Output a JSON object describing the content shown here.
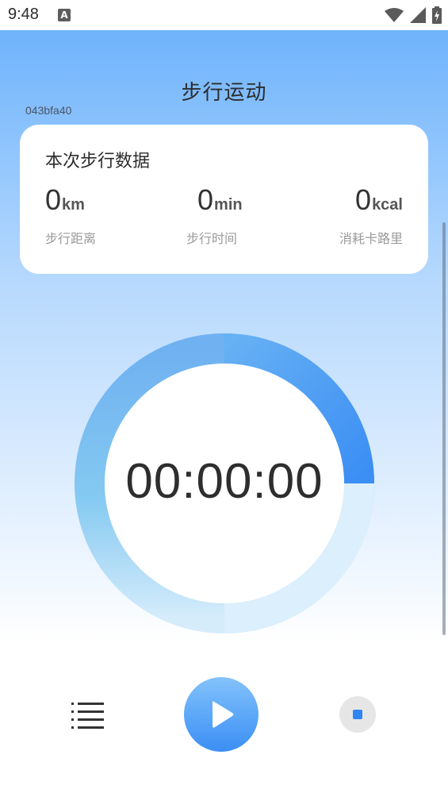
{
  "status_bar": {
    "time": "9:48",
    "notification_icon": "a-badge-icon",
    "icons": [
      "wifi-icon",
      "signal-icon",
      "battery-charging-icon"
    ]
  },
  "header": {
    "title": "步行运动",
    "device_id": "043bfa40"
  },
  "card": {
    "title": "本次步行数据",
    "stats": [
      {
        "value": "0",
        "unit": "km",
        "label": "步行距离"
      },
      {
        "value": "0",
        "unit": "min",
        "label": "步行时间"
      },
      {
        "value": "0",
        "unit": "kcal",
        "label": "消耗卡路里"
      }
    ]
  },
  "timer": {
    "display": "00:00:00"
  },
  "controls": {
    "list_icon": "list-icon",
    "play_icon": "play-icon",
    "stop_icon": "stop-icon"
  },
  "colors": {
    "accent": "#3b8ef4",
    "gradient_top": "#6fb3fb",
    "ring_light": "#dceffd",
    "text_dark": "#2e2e2e",
    "label_gray": "#9a9a9a"
  }
}
